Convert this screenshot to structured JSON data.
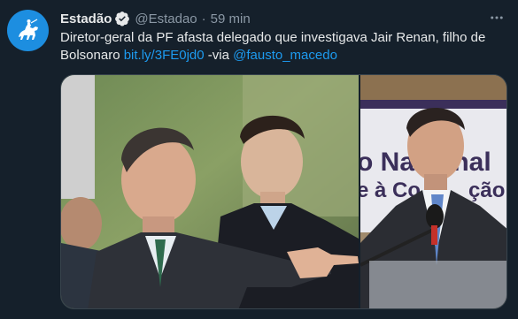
{
  "tweet": {
    "display_name": "Estadão",
    "handle": "@Estadao",
    "separator": "·",
    "time": "59 min",
    "text_main": "Diretor-geral da PF afasta delegado que investigava Jair Renan, filho de Bolsonaro ",
    "link": "bit.ly/3FE0jd0",
    "text_via": " -via ",
    "mention": "@fausto_macedo"
  },
  "media": {
    "right_sign_line1": "o Nacional",
    "right_sign_line2": "e à Co",
    "right_sign_line3": "ção"
  },
  "icons": {
    "avatar": "horse-rider-logo-icon",
    "verified": "verified-badge-icon",
    "more": "more-options-icon"
  },
  "colors": {
    "background": "#15202b",
    "text": "#e7e9ea",
    "secondary": "#8b98a5",
    "link": "#1d9bf0",
    "avatar": "#1d8ee0"
  }
}
